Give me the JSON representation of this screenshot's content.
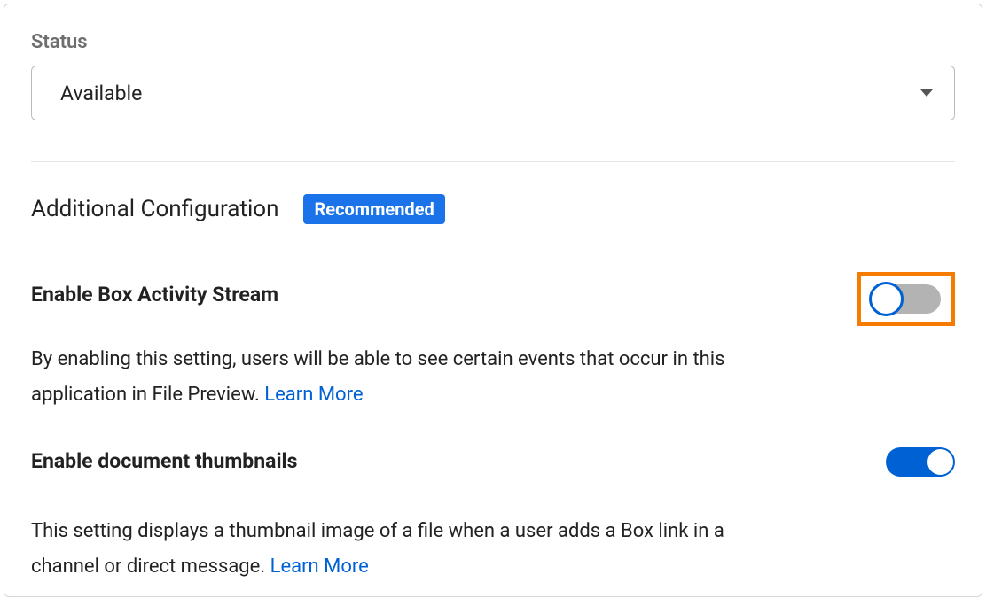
{
  "status": {
    "label": "Status",
    "value": "Available"
  },
  "section": {
    "title": "Additional Configuration",
    "badge": "Recommended"
  },
  "settings": {
    "activity_stream": {
      "title": "Enable Box Activity Stream",
      "desc_part1": "By enabling this setting, users will be able to see certain events that occur in this application in File Preview. ",
      "learn_more": "Learn More",
      "enabled": false
    },
    "thumbnails": {
      "title": "Enable document thumbnails",
      "desc_part1": "This setting displays a thumbnail image of a file when a user adds a Box link in a channel or direct message. ",
      "learn_more": "Learn More",
      "enabled": true
    }
  }
}
